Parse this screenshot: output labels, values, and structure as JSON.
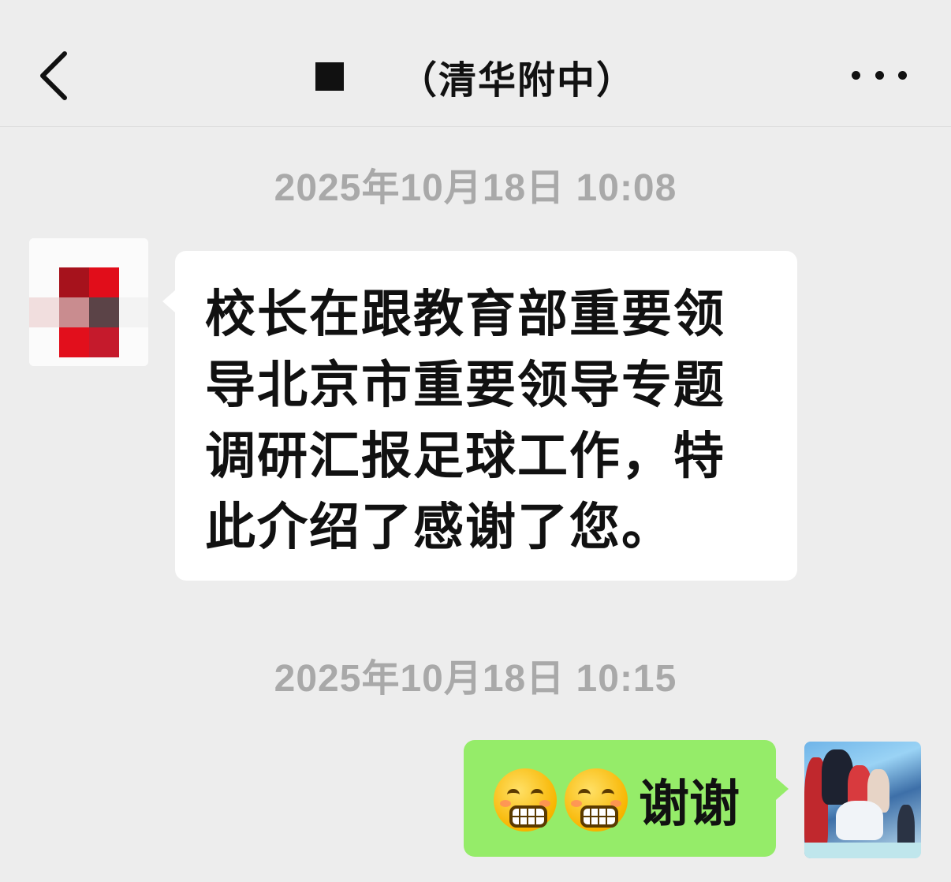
{
  "header": {
    "title": "（清华附中）",
    "back_icon": "chevron-left-icon",
    "more_icon": "more-dots-icon"
  },
  "messages": [
    {
      "timestamp": "2025年10月18日 10:08",
      "direction": "incoming",
      "text": "校长在跟教育部重要领导北京市重要领导专题调研汇报足球工作，特此介绍了感谢了您。"
    },
    {
      "timestamp": "2025年10月18日 10:15",
      "direction": "outgoing",
      "emoji": [
        "grinning-face-emoji",
        "grinning-face-emoji"
      ],
      "text": "谢谢"
    }
  ],
  "colors": {
    "background": "#ededed",
    "incoming_bubble": "#ffffff",
    "outgoing_bubble": "#95ec69",
    "timestamp": "#a9a9a9"
  }
}
